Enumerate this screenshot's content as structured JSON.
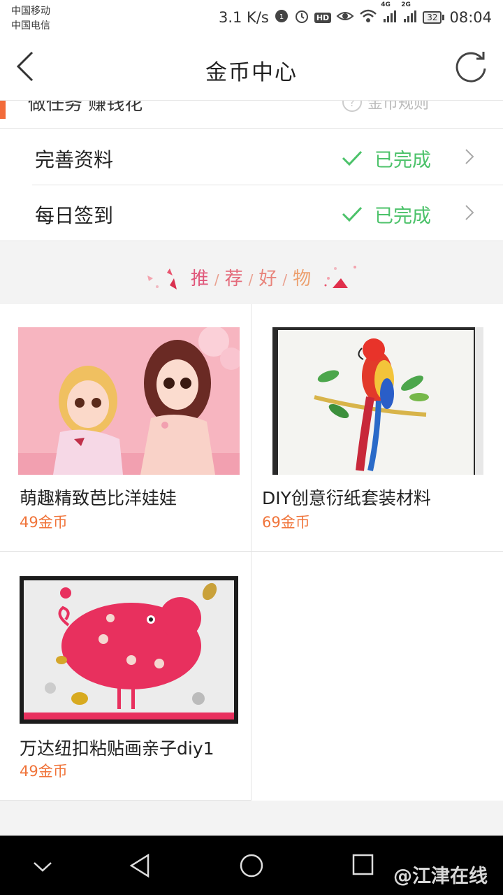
{
  "status_bar": {
    "carrier_1": "中国移动",
    "carrier_2": "中国电信",
    "speed": "3.1 K/s",
    "hd_badge": "HD",
    "net_4g": "4G",
    "net_2g": "2G",
    "battery": "32",
    "time": "08:04"
  },
  "header": {
    "title": "金币中心"
  },
  "partial_row": {
    "text": "做任务 赚钱花",
    "rules": "金币规则"
  },
  "tasks": [
    {
      "label": "完善资料",
      "status": "已完成"
    },
    {
      "label": "每日签到",
      "status": "已完成"
    }
  ],
  "section": {
    "chars": [
      "推",
      "荐",
      "好",
      "物"
    ]
  },
  "products": [
    {
      "name": "萌趣精致芭比洋娃娃",
      "price": "49金币"
    },
    {
      "name": "DIY创意衍纸套装材料",
      "price": "69金币"
    },
    {
      "name": "万达纽扣粘贴画亲子diy1",
      "price": "49金币"
    }
  ],
  "watermark": "@江津在线",
  "colors": {
    "accent": "#f26b3a",
    "done_green": "#4cc26a",
    "price_orange": "#f0743a",
    "section_pink": "#e0567a"
  }
}
